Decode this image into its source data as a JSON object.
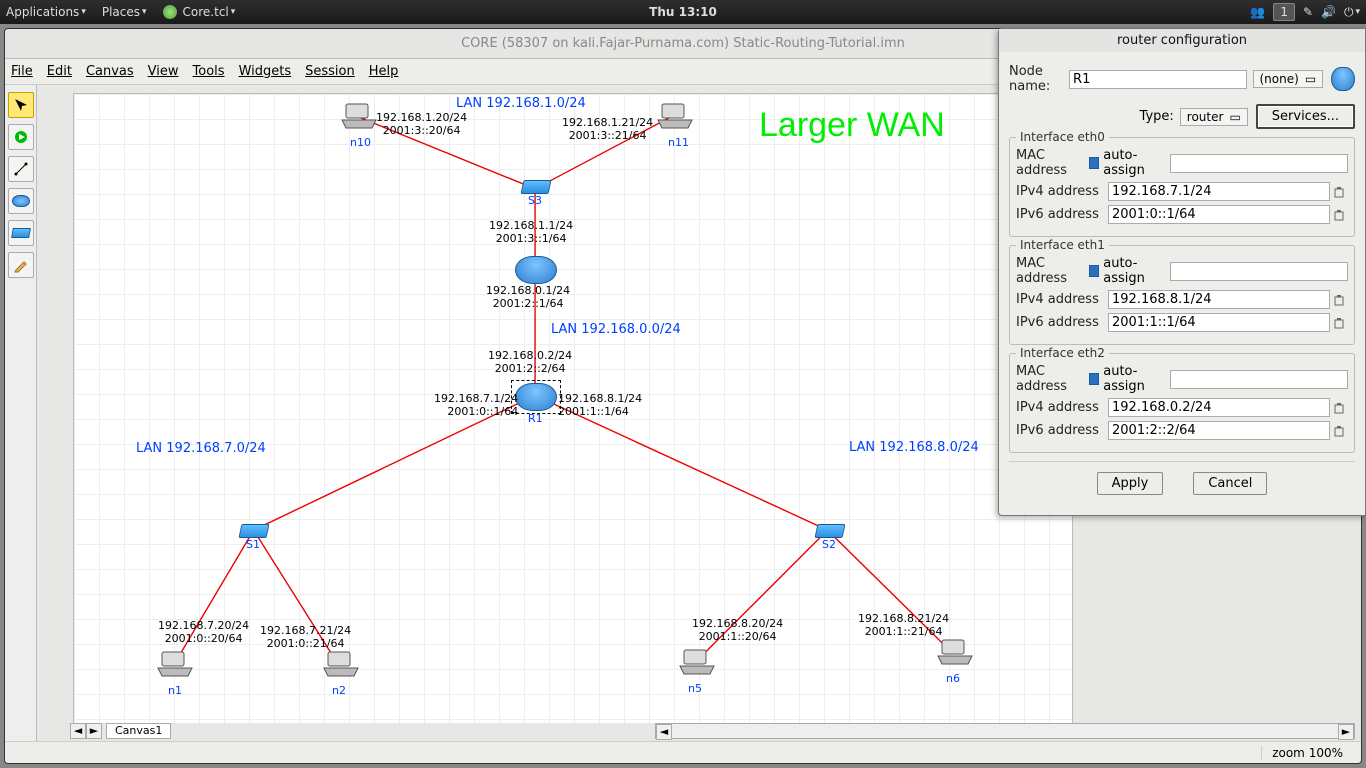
{
  "sysbar": {
    "applications": "Applications",
    "places": "Places",
    "app": "Core.tcl",
    "clock": "Thu 13:10",
    "workspace": "1"
  },
  "window": {
    "title": "CORE (58307 on kali.Fajar-Purnama.com) Static-Routing-Tutorial.imn"
  },
  "menubar": {
    "file": "File",
    "edit": "Edit",
    "canvas": "Canvas",
    "view": "View",
    "tools": "Tools",
    "widgets": "Widgets",
    "session": "Session",
    "help": "Help"
  },
  "canvas": {
    "tab": "Canvas1",
    "big": "Larger WAN",
    "lan1": "LAN 192.168.1.0/24",
    "lan0": "LAN 192.168.0.0/24",
    "lan7": "LAN 192.168.7.0/24",
    "lan8": "LAN 192.168.8.0/24",
    "n10": {
      "name": "n10",
      "ip": "192.168.1.20/24",
      "ip6": "2001:3::20/64"
    },
    "n11": {
      "name": "n11",
      "ip": "192.168.1.21/24",
      "ip6": "2001:3::21/64"
    },
    "s3": "S3",
    "r2a": {
      "ip": "192.168.1.1/24",
      "ip6": "2001:3::1/64"
    },
    "r2b": {
      "ip": "192.168.0.1/24",
      "ip6": "2001:2::1/64"
    },
    "r1up": {
      "ip": "192.168.0.2/24",
      "ip6": "2001:2::2/64"
    },
    "r1l": {
      "ip": "192.168.7.1/24",
      "ip6": "2001:0::1/64"
    },
    "r1r": {
      "ip": "192.168.8.1/24",
      "ip6": "2001:1::1/64"
    },
    "r1name": "R1",
    "s1": "S1",
    "s2": "S2",
    "n1": {
      "name": "n1",
      "ip": "192.168.7.20/24",
      "ip6": "2001:0::20/64"
    },
    "n2": {
      "name": "n2",
      "ip": "192.168.7.21/24",
      "ip6": "2001:0::21/64"
    },
    "n5": {
      "name": "n5",
      "ip": "192.168.8.20/24",
      "ip6": "2001:1::20/64"
    },
    "n6": {
      "name": "n6",
      "ip": "192.168.8.21/24",
      "ip6": "2001:1::21/64"
    }
  },
  "status": {
    "zoom": "zoom 100%"
  },
  "dialog": {
    "title": "router configuration",
    "nodename_lbl": "Node name:",
    "nodename": "R1",
    "none": "(none)",
    "type_lbl": "Type:",
    "type": "router",
    "services": "Services...",
    "mac_lbl": "MAC address",
    "autoassign": "auto-assign",
    "ipv4_lbl": "IPv4 address",
    "ipv6_lbl": "IPv6 address",
    "eth0": {
      "legend": "Interface eth0",
      "mac": "",
      "ipv4": "192.168.7.1/24",
      "ipv6": "2001:0::1/64"
    },
    "eth1": {
      "legend": "Interface eth1",
      "mac": "",
      "ipv4": "192.168.8.1/24",
      "ipv6": "2001:1::1/64"
    },
    "eth2": {
      "legend": "Interface eth2",
      "mac": "",
      "ipv4": "192.168.0.2/24",
      "ipv6": "2001:2::2/64"
    },
    "apply": "Apply",
    "cancel": "Cancel"
  }
}
